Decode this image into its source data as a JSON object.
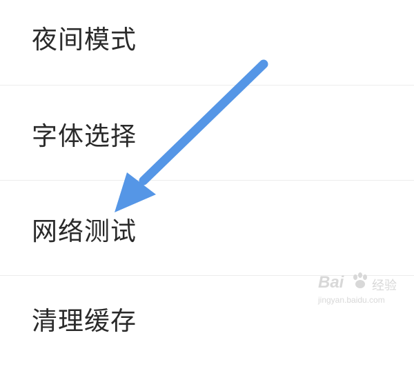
{
  "settings": {
    "items": [
      {
        "label": "夜间模式"
      },
      {
        "label": "字体选择"
      },
      {
        "label": "网络测试"
      },
      {
        "label": "清理缓存"
      }
    ]
  },
  "arrow": {
    "color": "#5596e6"
  },
  "watermark": {
    "brand": "Bai",
    "suffix": "经验",
    "domain": "jingyan.baidu.com"
  }
}
